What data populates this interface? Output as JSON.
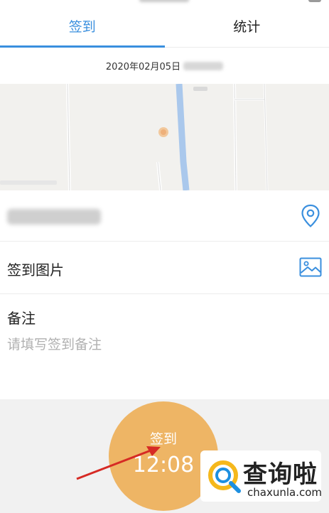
{
  "tabs": [
    {
      "label": "签到",
      "active": true
    },
    {
      "label": "统计",
      "active": false
    }
  ],
  "date": {
    "text": "2020年02月05日"
  },
  "photo_row": {
    "label": "签到图片"
  },
  "remark": {
    "title": "备注",
    "placeholder": "请填写签到备注"
  },
  "checkin": {
    "label": "签到",
    "time": "12:08"
  },
  "watermark": {
    "brand_cn": "查询啦",
    "brand_en": "chaxunla.com"
  },
  "colors": {
    "accent": "#3a8fde",
    "button": "#eeb565",
    "arrow": "#d62a24"
  },
  "icons": [
    "location-pin-icon",
    "image-icon",
    "arrow-annotation",
    "chaxunla-logo"
  ]
}
